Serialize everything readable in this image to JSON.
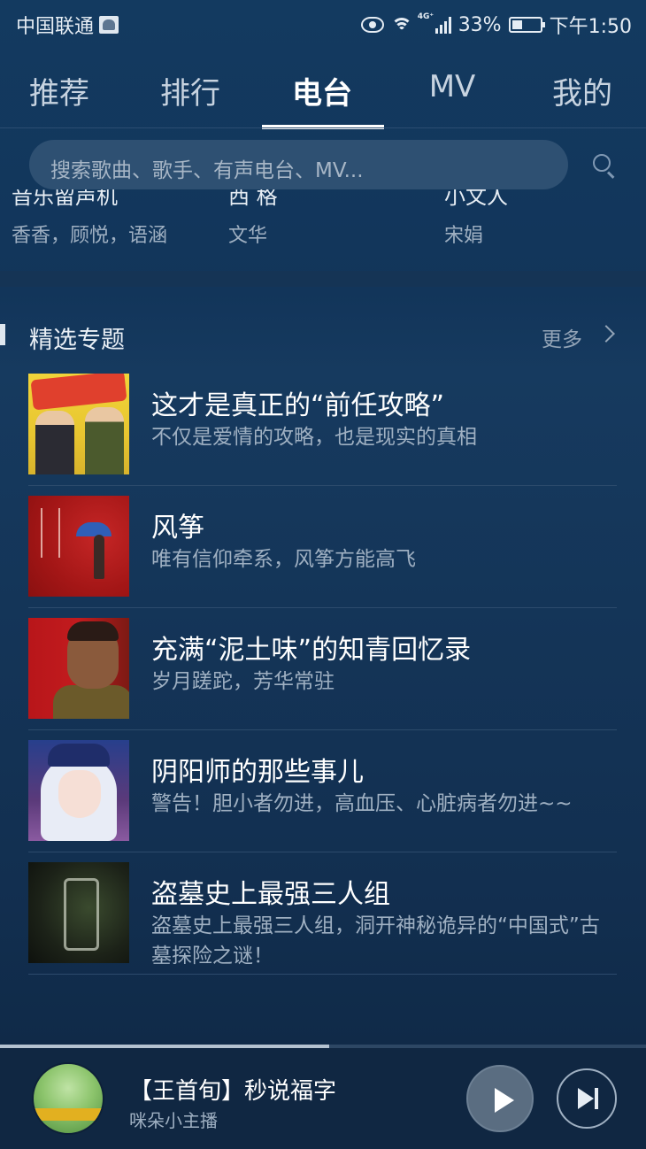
{
  "status_bar": {
    "carrier": "中国联通",
    "network": "4G⁺",
    "battery": "33%",
    "time": "下午1:50"
  },
  "tabs": [
    {
      "label": "推荐",
      "active": false
    },
    {
      "label": "排行",
      "active": false
    },
    {
      "label": "电台",
      "active": true
    },
    {
      "label": "MV",
      "active": false
    },
    {
      "label": "我的",
      "active": false
    }
  ],
  "search": {
    "placeholder": "搜索歌曲、歌手、有声电台、MV..."
  },
  "radio_row": [
    {
      "name": "音乐留声机",
      "host": "香香，顾悦，语涵"
    },
    {
      "name": "西 格",
      "host": "文华"
    },
    {
      "name": "小文人",
      "host": "宋娟"
    }
  ],
  "section": {
    "title": "精选专题",
    "more_label": "更多"
  },
  "topics": [
    {
      "title": "这才是真正的“前任攻略”",
      "subtitle": "不仅是爱情的攻略，也是现实的真相"
    },
    {
      "title": "风筝",
      "subtitle": "唯有信仰牵系，风筝方能高飞"
    },
    {
      "title": "充满“泥土味”的知青回忆录",
      "subtitle": "岁月蹉跎，芳华常驻"
    },
    {
      "title": "阴阳师的那些事儿",
      "subtitle": "警告！胆小者勿进，高血压、心脏病者勿进~~"
    },
    {
      "title": "盗墓史上最强三人组",
      "subtitle": "盗墓史上最强三人组，洞开神秘诡异的“中国式”古墓探险之谜！"
    }
  ],
  "player": {
    "title": "【王首旬】秒说福字",
    "subtitle": "咪朵小主播",
    "progress": 0.51
  },
  "colors": {
    "background": "#133a60",
    "active_tab": "#ffffff",
    "secondary_text": "#9fb0c2"
  }
}
